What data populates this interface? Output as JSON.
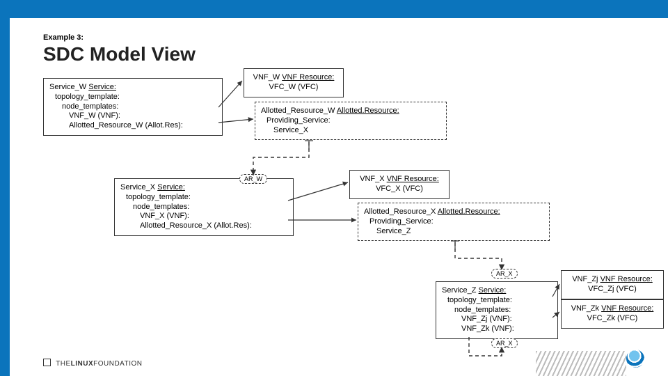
{
  "header": {
    "example_label": "Example 3:",
    "title": "SDC Model View"
  },
  "service_w": {
    "heading_name": "Service_W ",
    "heading_type": "Service:",
    "l1": "topology_template:",
    "l2": "node_templates:",
    "l3": "VNF_W (VNF):",
    "l4": "Allotted_Resource_W (Allot.Res):"
  },
  "vnf_w": {
    "line1_name": "VNF_W ",
    "line1_type": "VNF Resource:",
    "line2": "VFC_W (VFC)"
  },
  "allotted_w": {
    "heading_name": "Allotted_Resource_W ",
    "heading_type": "Allotted.Resource:",
    "l1": "Providing_Service:",
    "l2": "Service_X"
  },
  "service_x": {
    "heading_name": "Service_X ",
    "heading_type": "Service:",
    "l1": "topology_template:",
    "l2": "node_templates:",
    "l3": "VNF_X (VNF):",
    "l4": "Allotted_Resource_X (Allot.Res):"
  },
  "vnf_x": {
    "line1_name": "VNF_X ",
    "line1_type": "VNF Resource:",
    "line2": "VFC_X (VFC)"
  },
  "allotted_x": {
    "heading_name": "Allotted_Resource_X ",
    "heading_type": "Allotted.Resource:",
    "l1": "Providing_Service:",
    "l2": "Service_Z"
  },
  "service_z": {
    "heading_name": "Service_Z ",
    "heading_type": "Service:",
    "l1": "topology_template:",
    "l2": "node_templates:",
    "l3": "VNF_Zj (VNF):",
    "l4": "VNF_Zk (VNF):"
  },
  "vnf_zj": {
    "line1_name": "VNF_Zj ",
    "line1_type": "VNF Resource:",
    "line2": "VFC_Zj (VFC)"
  },
  "vnf_zk": {
    "line1_name": "VNF_Zk ",
    "line1_type": "VNF Resource:",
    "line2": "VFC_Zk (VFC)"
  },
  "pills": {
    "ar_w": "AR_W",
    "ar_x_top": "AR_X",
    "ar_x_bottom": "AR_X"
  },
  "footer": {
    "brand_prefix": "THE",
    "brand_bold": "LINUX",
    "brand_suffix": "FOUNDATION"
  }
}
